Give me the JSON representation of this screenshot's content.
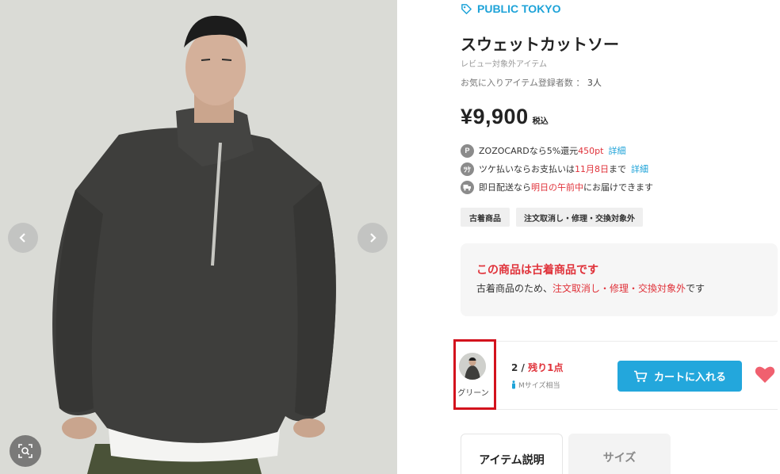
{
  "gallery": {
    "prev_icon": "chevron-left-icon",
    "next_icon": "chevron-right-icon",
    "zoom_icon": "image-search-icon"
  },
  "product": {
    "brand": "PUBLIC TOKYO",
    "brand_icon": "tag-icon",
    "title": "スウェットカットソー",
    "review_note": "レビュー対象外アイテム",
    "favorites_label": "お気に入りアイテム登録者数 ：",
    "favorites_count": "3人",
    "price": "¥9,900",
    "tax_label": "税込"
  },
  "perks": {
    "zozocard": {
      "icon_text": "P",
      "text": "ZOZOCARDなら5%還元",
      "highlight": "450pt",
      "link": "詳細"
    },
    "tsuke": {
      "icon_text": "ﾂｹ",
      "text_a": "ツケ払いならお支払いは",
      "highlight": "11月8日",
      "text_b": "まで",
      "link": "詳細"
    },
    "delivery": {
      "text_a": "即日配送なら",
      "highlight": "明日の午前中",
      "text_b": "にお届けできます"
    }
  },
  "tags": [
    "古着商品",
    "注文取消し・修理・交換対象外"
  ],
  "notice": {
    "title": "この商品は古着商品です",
    "body_a": "古着商品のため、",
    "body_highlight": "注文取消し・修理・交換対象外",
    "body_b": "です"
  },
  "sku": {
    "color_label": "グリーン",
    "size": "2 /",
    "stock": "残り1点",
    "size_hint": "Mサイズ相当",
    "cart_label": "カートに入れる",
    "colors": {
      "accent": "#23a7dc",
      "alert": "#e0323a",
      "heart": "#f0606f"
    }
  },
  "tabs": [
    {
      "label": "アイテム説明",
      "active": true
    },
    {
      "label": "サイズ",
      "active": false
    }
  ]
}
